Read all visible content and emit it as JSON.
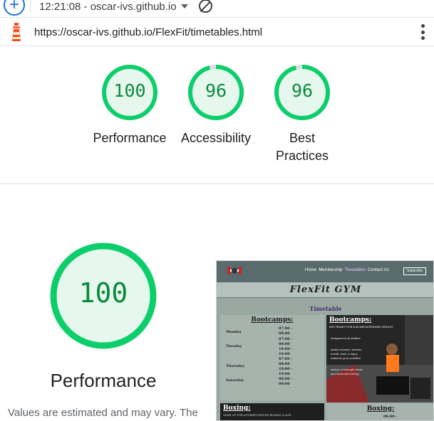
{
  "topbar": {
    "timestamp": "12:21:08 - oscar-ivs.github.io",
    "add_icon": "plus-circle-icon",
    "dropdown_icon": "caret-down-icon",
    "blocked_icon": "no-entry-icon"
  },
  "urlbar": {
    "site_icon": "lighthouse-icon",
    "url": "https://oscar-ivs.github.io/FlexFit/timetables.html",
    "menu_icon": "kebab-menu-icon"
  },
  "scores": [
    {
      "value": "100",
      "label": "Performance",
      "fraction": 1.0
    },
    {
      "value": "96",
      "label": "Accessibility",
      "fraction": 0.96
    },
    {
      "value": "96",
      "label": "Best Practices",
      "fraction": 0.96
    }
  ],
  "performance": {
    "value": "100",
    "fraction": 1.0,
    "label": "Performance",
    "note": "Values are estimated and may vary. The"
  },
  "colors": {
    "pass": "#0cce6b",
    "pass_fill": "#e6f8ee",
    "pass_text": "#0c8a3c"
  },
  "thumbnail": {
    "nav": [
      "Home",
      "Membership",
      "Timetables",
      "Contact Us"
    ],
    "active_nav": "Timetables",
    "subscribe": "Subscribe",
    "brand": "FlexFit GYM",
    "section_title": "Timetable",
    "bootcamps_title": "Bootcamps:",
    "days": [
      "Monday",
      "Tuesday",
      "Thursday",
      "Saturday"
    ],
    "times": [
      "07:00 -",
      "08:00",
      "07:00 -",
      "08:00",
      "18:00 -",
      "19:00",
      "07:00 -",
      "08:00",
      "18:00 -",
      "19:00",
      "08:00 -",
      "09:00"
    ],
    "promo_title": "Bootcamps:",
    "promo_line": "GET READY FOR A 60 MIN INTENSIVE CIRCUIT",
    "promo_bullets": [
      "designed for all abilities",
      "totally inclusive, whether",
      "mobile, level or injury",
      "whatever your condition",
      "mixture of strength cardio",
      "and functional training"
    ],
    "boxing_title": "Boxing:",
    "boxing_line": "GEAR UP FOR A POWER-PACKED BOXING CLASS",
    "boxing_right_title": "Boxing:",
    "boxing_right_time": "09:00 -"
  }
}
